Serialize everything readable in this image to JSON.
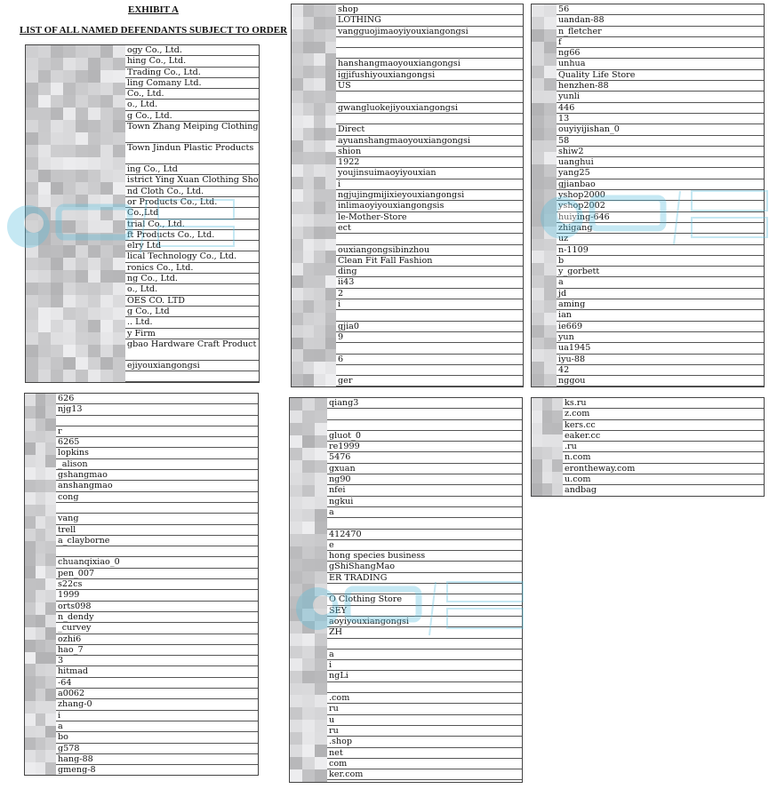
{
  "header": {
    "exhibit": "EXHIBIT A",
    "subtitle": "LIST OF ALL NAMED DEFENDANTS SUBJECT TO ORDER"
  },
  "watermark": {
    "logo_text": "赛贝",
    "slogan": "云端知识 产权大平台",
    "site": "www.saibeiip.com",
    "color": "#5bc0de"
  },
  "panels": [
    {
      "rows": [
        "ogy Co., Ltd.",
        "hing Co., Ltd.",
        "Trading Co., Ltd.",
        "ling Comany Ltd.",
        "Co., Ltd.",
        "o., Ltd.",
        "g Co., Ltd.",
        "Town Zhang Meiping Clothing",
        "Town Jindun Plastic Products",
        "ing Co., Ltd",
        "istrict Ying Xuan Clothing Shop",
        "nd Cloth Co., Ltd.",
        "or Products Co., Ltd.",
        "Co.,Ltd",
        "trial Co., Ltd.",
        "ft Products Co., Ltd.",
        "elry Ltd",
        "lical Technology Co., Ltd.",
        "ronics Co., Ltd.",
        "ng Co., Ltd.",
        "o., Ltd.",
        "OES CO. LTD",
        "g Co., Ltd",
        ".. Ltd.",
        "y Firm",
        "gbao Hardware Craft Product",
        "ejiyouxiangongsi",
        ""
      ]
    },
    {
      "rows": [
        "shop",
        "LOTHING",
        "vangguojimaoyiyouxiangongsi",
        "",
        "",
        "hanshangmaoyouxiangongsi",
        "igjifushiyouxiangongsi",
        "US",
        "",
        "gwangluokejiyouxiangongsi",
        "",
        "Direct",
        "ayuanshangmaoyouxiangongsi",
        "shion",
        "1922",
        "youjinsuimaoyiyouxian",
        "i",
        "ngjujingmijixieyouxiangongsi",
        "inlimaoyiyouxiangongsis",
        "le-Mother-Store",
        "ect",
        "",
        "ouxiangongsibinzhou",
        "Clean Fit Fall Fashion",
        "ding",
        "ii43",
        "2",
        "i",
        "",
        "gjia0",
        "9",
        "",
        "6",
        "",
        "ger"
      ]
    },
    {
      "rows": [
        "56",
        "uandan-88",
        "n_fletcher",
        "f",
        "ng66",
        "unhua",
        "Quality Life Store",
        "henzhen-88",
        "yunli",
        "446",
        "13",
        "ouyiyijishan_0",
        "58",
        "shiw2",
        "uanghui",
        "yang25",
        "gjianbao",
        "yshop2000",
        "yshop2002",
        "huiying-646",
        "zhigang",
        "uz",
        "n-1109",
        "b",
        "y_gorbett",
        "a",
        "jd",
        "aming",
        "ian",
        "ie669",
        "yun",
        "ua1945",
        "iyu-88",
        "42",
        "nggou"
      ]
    },
    {
      "rows": [
        "626",
        "njg13",
        "",
        "r",
        "6265",
        "lopkins",
        "_alison",
        "gshangmao",
        "anshangmao",
        "cong",
        "",
        "vang",
        "trell",
        "a_clayborne",
        "",
        "chuanqixiao_0",
        "pen_007",
        "s22cs",
        "1999",
        "orts098",
        "n_dendy",
        "_curvey",
        "ozhi6",
        "hao_7",
        "3",
        "hitmad",
        "-64",
        "a0062",
        "zhang-0",
        "i",
        "a",
        "bo",
        "g578",
        "hang-88",
        "gmeng-8"
      ]
    },
    {
      "rows": [
        "qiang3",
        "",
        "",
        "gluot_0",
        "re1999",
        "5476",
        "gxuan",
        "ng90",
        "nfei",
        "ngkui",
        "a",
        "",
        "412470",
        "e",
        "hong species business",
        "gShiShangMao",
        "ER TRADING",
        "",
        "O Clothing Store",
        "SEY",
        "aoyiyouxiangongsi",
        "ZH",
        "",
        "a",
        "i",
        "ngLi",
        "",
        ".com",
        "ru",
        "u",
        "ru",
        ".shop",
        "net",
        "com",
        "ker.com"
      ]
    },
    {
      "rows": [
        "ks.ru",
        "z.com",
        "kers.cc",
        "eaker.cc",
        ".ru",
        "n.com",
        "erontheway.com",
        "u.com",
        "andbag"
      ]
    }
  ]
}
